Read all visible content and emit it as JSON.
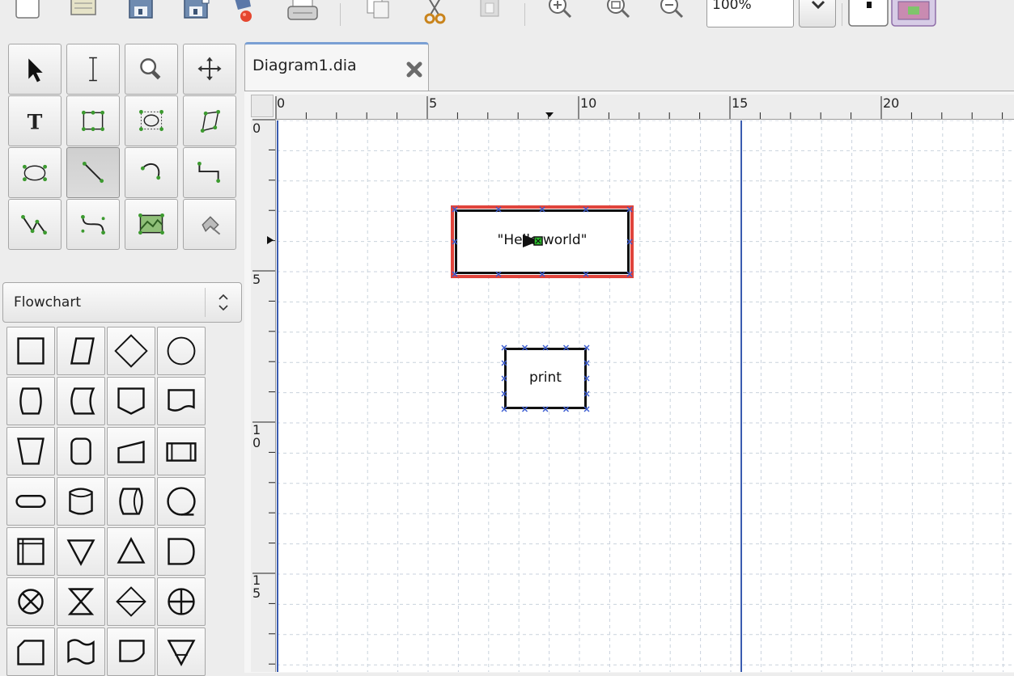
{
  "toolbar": {
    "buttons": [
      {
        "name": "new-diagram-icon"
      },
      {
        "name": "open-file-icon"
      },
      {
        "name": "save-icon"
      },
      {
        "name": "save-as-icon"
      },
      {
        "name": "export-icon"
      },
      {
        "name": "print-icon"
      },
      {
        "name": "copy-icon"
      },
      {
        "name": "cut-icon"
      },
      {
        "name": "paste-icon"
      },
      {
        "name": "zoom-in-icon"
      },
      {
        "name": "zoom-fit-icon"
      },
      {
        "name": "zoom-out-icon"
      }
    ],
    "zoom_value": "100%"
  },
  "tools": [
    "pointer-tool-icon",
    "text-edit-tool-icon",
    "magnify-tool-icon",
    "scroll-tool-icon",
    "text-tool-icon",
    "box-tool-icon",
    "ellipse-tool-icon",
    "polygon-tool-icon",
    "beziergon-tool-icon",
    "line-tool-icon",
    "arc-tool-icon",
    "zigzag-line-tool-icon",
    "polyline-tool-icon",
    "bezier-line-tool-icon",
    "image-tool-icon",
    "outline-tool-icon"
  ],
  "sheet_selector": {
    "label": "Flowchart"
  },
  "tab": {
    "title": "Diagram1.dia"
  },
  "rulers": {
    "horizontal_labels": [
      "0",
      "5",
      "10",
      "15",
      "20"
    ],
    "vertical_labels": [
      "0",
      "5",
      "1\n0",
      "1\n5"
    ]
  },
  "diagram": {
    "nodes": [
      {
        "label": "\"Hello world\"",
        "selected": true
      },
      {
        "label": "print",
        "selected": false
      }
    ]
  },
  "colors": {
    "selection_outline": "#e0443c",
    "connection_point": "#3a5bd0",
    "page_break_line": "#3a5cb0",
    "grid_line": "#c9d2dc"
  }
}
